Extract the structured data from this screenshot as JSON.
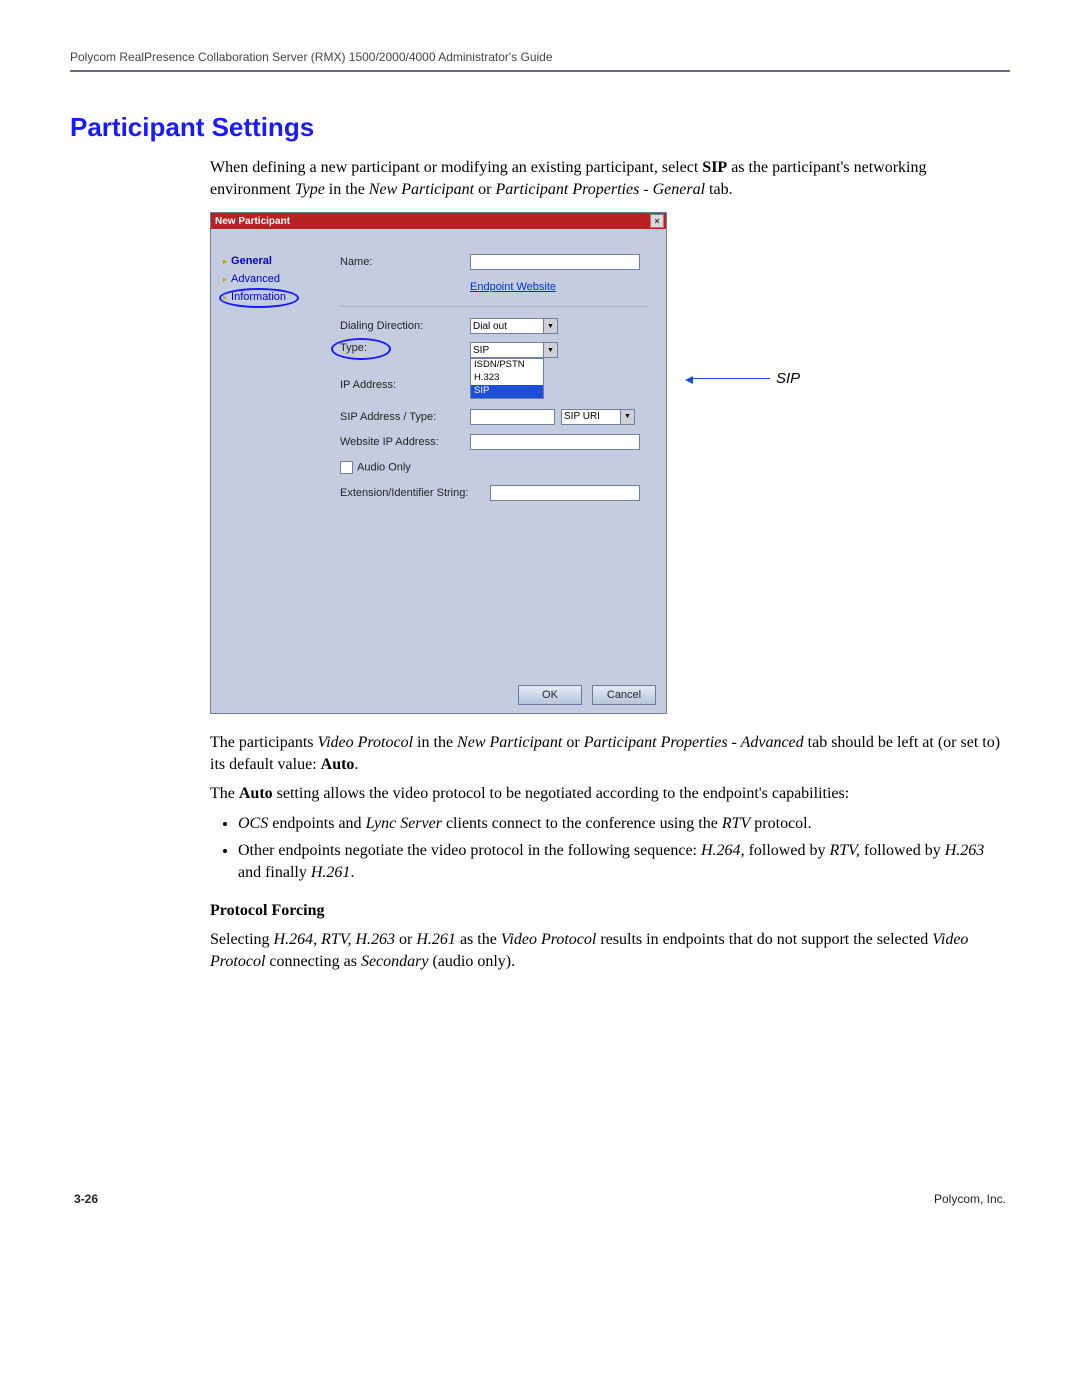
{
  "header": "Polycom RealPresence Collaboration Server (RMX) 1500/2000/4000 Administrator's Guide",
  "title": "Participant Settings",
  "intro": {
    "p1a": "When defining a new participant or modifying an existing participant, select ",
    "p1b": "SIP",
    "p1c": " as the participant's networking environment ",
    "p1d": "Type",
    "p1e": " in the ",
    "p1f": "New Participant",
    "p1g": " or ",
    "p1h": "Participant Properties - General",
    "p1i": " tab."
  },
  "dlg": {
    "title": "New Participant",
    "side": {
      "general": "General",
      "advanced": "Advanced",
      "information": "Information"
    },
    "labels": {
      "name": "Name:",
      "endpoint": "Endpoint Website",
      "dialdir": "Dialing Direction:",
      "type": "Type:",
      "ip": "IP Address:",
      "sipaddr": "SIP Address / Type:",
      "webip": "Website IP Address:",
      "audio": "Audio Only",
      "ext": "Extension/Identifier String:"
    },
    "vals": {
      "dialout": "Dial out",
      "sip": "SIP",
      "sipuri": "SIP URI",
      "listISDN": "ISDN/PSTN",
      "listH323": "H.323",
      "listSIP": "SIP"
    },
    "btns": {
      "ok": "OK",
      "cancel": "Cancel"
    }
  },
  "callout": "SIP",
  "body": {
    "p2a": "The participants ",
    "p2b": "Video Protocol",
    "p2c": " in the ",
    "p2d": "New Participant",
    "p2e": " or ",
    "p2f": "Participant Properties - Advanced",
    "p2g": " tab should be left at (or set to) its default value: ",
    "p2h": "Auto",
    "p2i": ".",
    "p3a": "The ",
    "p3b": "Auto",
    "p3c": " setting allows the video protocol to be negotiated according to the endpoint's capabilities:",
    "b1a": "OCS",
    "b1b": " endpoints and ",
    "b1c": "Lync Server",
    "b1d": " clients connect to the conference using the ",
    "b1e": "RTV",
    "b1f": " protocol.",
    "b2a": "Other endpoints negotiate the video protocol in the following sequence: ",
    "b2b": "H.264",
    "b2c": ", followed by ",
    "b2d": "RTV,",
    "b2e": " followed by ",
    "b2f": "H.263",
    "b2g": " and finally ",
    "b2h": "H.261",
    "b2i": ".",
    "pfh": "Protocol Forcing",
    "pf1": "Selecting ",
    "pf2": "H.264, RTV, H.263",
    "pf3": " or ",
    "pf4": "H.261",
    "pf5": " as the ",
    "pf6": "Video Protocol",
    "pf7": " results in endpoints that do not support the selected ",
    "pf8": "Video Protocol",
    "pf9": " connecting as ",
    "pf10": "Secondary",
    "pf11": " (audio only)."
  },
  "footer": {
    "left": "3-26",
    "right": "Polycom, Inc."
  }
}
